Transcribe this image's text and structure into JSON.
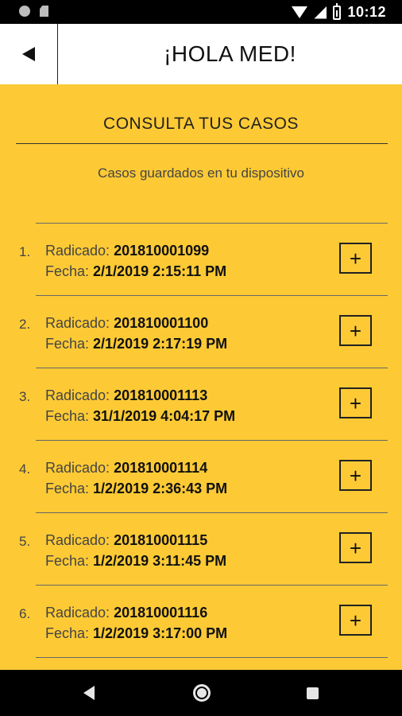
{
  "status_bar": {
    "time": "10:12"
  },
  "app_bar": {
    "title": "¡HOLA MED!"
  },
  "content": {
    "section_title": "CONSULTA TUS CASOS",
    "subtitle": "Casos guardados en tu dispositivo",
    "radicado_label": "Radicado: ",
    "fecha_label": "Fecha: ",
    "plus_label": "+",
    "cases": [
      {
        "number": "1.",
        "radicado": "201810001099",
        "fecha": "2/1/2019 2:15:11 PM"
      },
      {
        "number": "2.",
        "radicado": "201810001100",
        "fecha": "2/1/2019 2:17:19 PM"
      },
      {
        "number": "3.",
        "radicado": "201810001113",
        "fecha": "31/1/2019 4:04:17 PM"
      },
      {
        "number": "4.",
        "radicado": "201810001114",
        "fecha": "1/2/2019 2:36:43 PM"
      },
      {
        "number": "5.",
        "radicado": "201810001115",
        "fecha": "1/2/2019 3:11:45 PM"
      },
      {
        "number": "6.",
        "radicado": "201810001116",
        "fecha": "1/2/2019 3:17:00 PM"
      }
    ]
  },
  "colors": {
    "accent": "#fdca35",
    "text": "#222222"
  }
}
